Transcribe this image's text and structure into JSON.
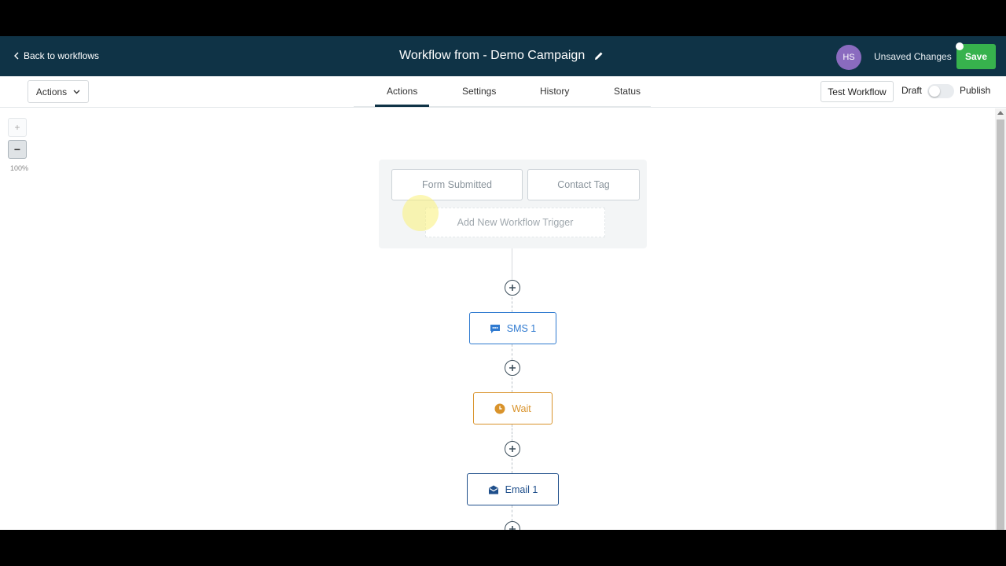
{
  "header": {
    "back_label": "Back to workflows",
    "title": "Workflow from - Demo Campaign",
    "avatar_initials": "HS",
    "unsaved_label": "Unsaved Changes",
    "save_label": "Save"
  },
  "toolbar": {
    "actions_dropdown": "Actions",
    "tabs": [
      {
        "label": "Actions",
        "active": true
      },
      {
        "label": "Settings",
        "active": false
      },
      {
        "label": "History",
        "active": false
      },
      {
        "label": "Status",
        "active": false
      }
    ],
    "test_label": "Test Workflow",
    "draft_label": "Draft",
    "publish_label": "Publish",
    "published": false
  },
  "canvas": {
    "zoom_in": "+",
    "zoom_out": "−",
    "zoom_level": "100%",
    "triggers": [
      "Form Submitted",
      "Contact Tag"
    ],
    "add_trigger_label": "Add New Workflow Trigger",
    "nodes": [
      {
        "label": "SMS 1",
        "icon": "sms-icon",
        "color": "#2f7ad0"
      },
      {
        "label": "Wait",
        "icon": "clock-icon",
        "color": "#d9932b"
      },
      {
        "label": "Email 1",
        "icon": "email-icon",
        "color": "#1f4f8b"
      }
    ]
  },
  "colors": {
    "header_bg": "#0f3346",
    "save_green": "#37b24d",
    "avatar_purple": "#8a6bbf"
  }
}
